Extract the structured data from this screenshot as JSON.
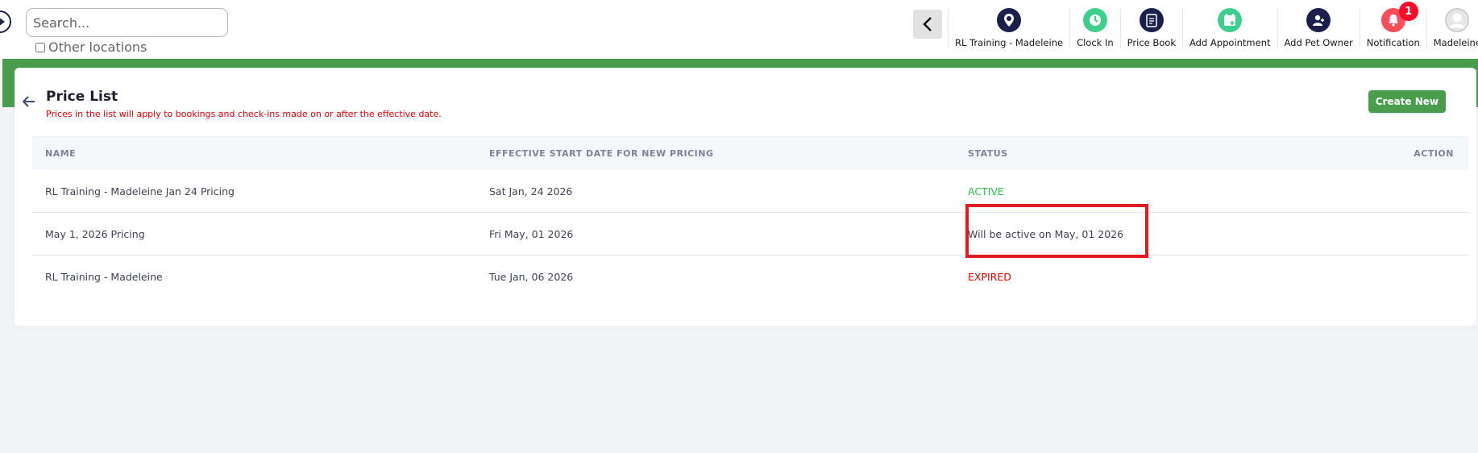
{
  "search": {
    "placeholder": "Search..."
  },
  "other_locations_label": "Other locations",
  "nav": [
    {
      "label": "RL Training - Madeleine",
      "icon": "location-pin-icon",
      "color": "#1b1f4b"
    },
    {
      "label": "Clock In",
      "icon": "clock-icon",
      "color": "#3ecf8e"
    },
    {
      "label": "Price Book",
      "icon": "document-icon",
      "color": "#1b1f4b"
    },
    {
      "label": "Add Appointment",
      "icon": "calendar-plus-icon",
      "color": "#3ecf8e"
    },
    {
      "label": "Add Pet Owner",
      "icon": "add-user-icon",
      "color": "#1b1f4b"
    },
    {
      "label": "Notification",
      "icon": "bell-icon",
      "color": "#ff4d5a",
      "badge": "1"
    },
    {
      "label": "Madeleine",
      "icon": "avatar-icon",
      "color": "#c8c8c8"
    }
  ],
  "page": {
    "title": "Price List",
    "subtitle": "Prices in the list will apply to bookings and check-ins made on or after the effective date.",
    "create_button": "Create New"
  },
  "table": {
    "headers": [
      "NAME",
      "EFFECTIVE START DATE FOR NEW PRICING",
      "STATUS",
      "ACTION"
    ],
    "rows": [
      {
        "name": "RL Training - Madeleine Jan 24 Pricing",
        "date": "Sat Jan, 24 2026",
        "status": "ACTIVE",
        "status_type": "active"
      },
      {
        "name": "May 1, 2026 Pricing",
        "date": "Fri May, 01 2026",
        "status": "Will be active on May, 01 2026",
        "status_type": "pending"
      },
      {
        "name": "RL Training - Madeleine",
        "date": "Tue Jan, 06 2026",
        "status": "EXPIRED",
        "status_type": "expired"
      }
    ]
  },
  "colors": {
    "brand_green": "#4a9d4d",
    "active": "#2dbf4e",
    "expired": "#e60000",
    "highlight": "#e01b24"
  }
}
